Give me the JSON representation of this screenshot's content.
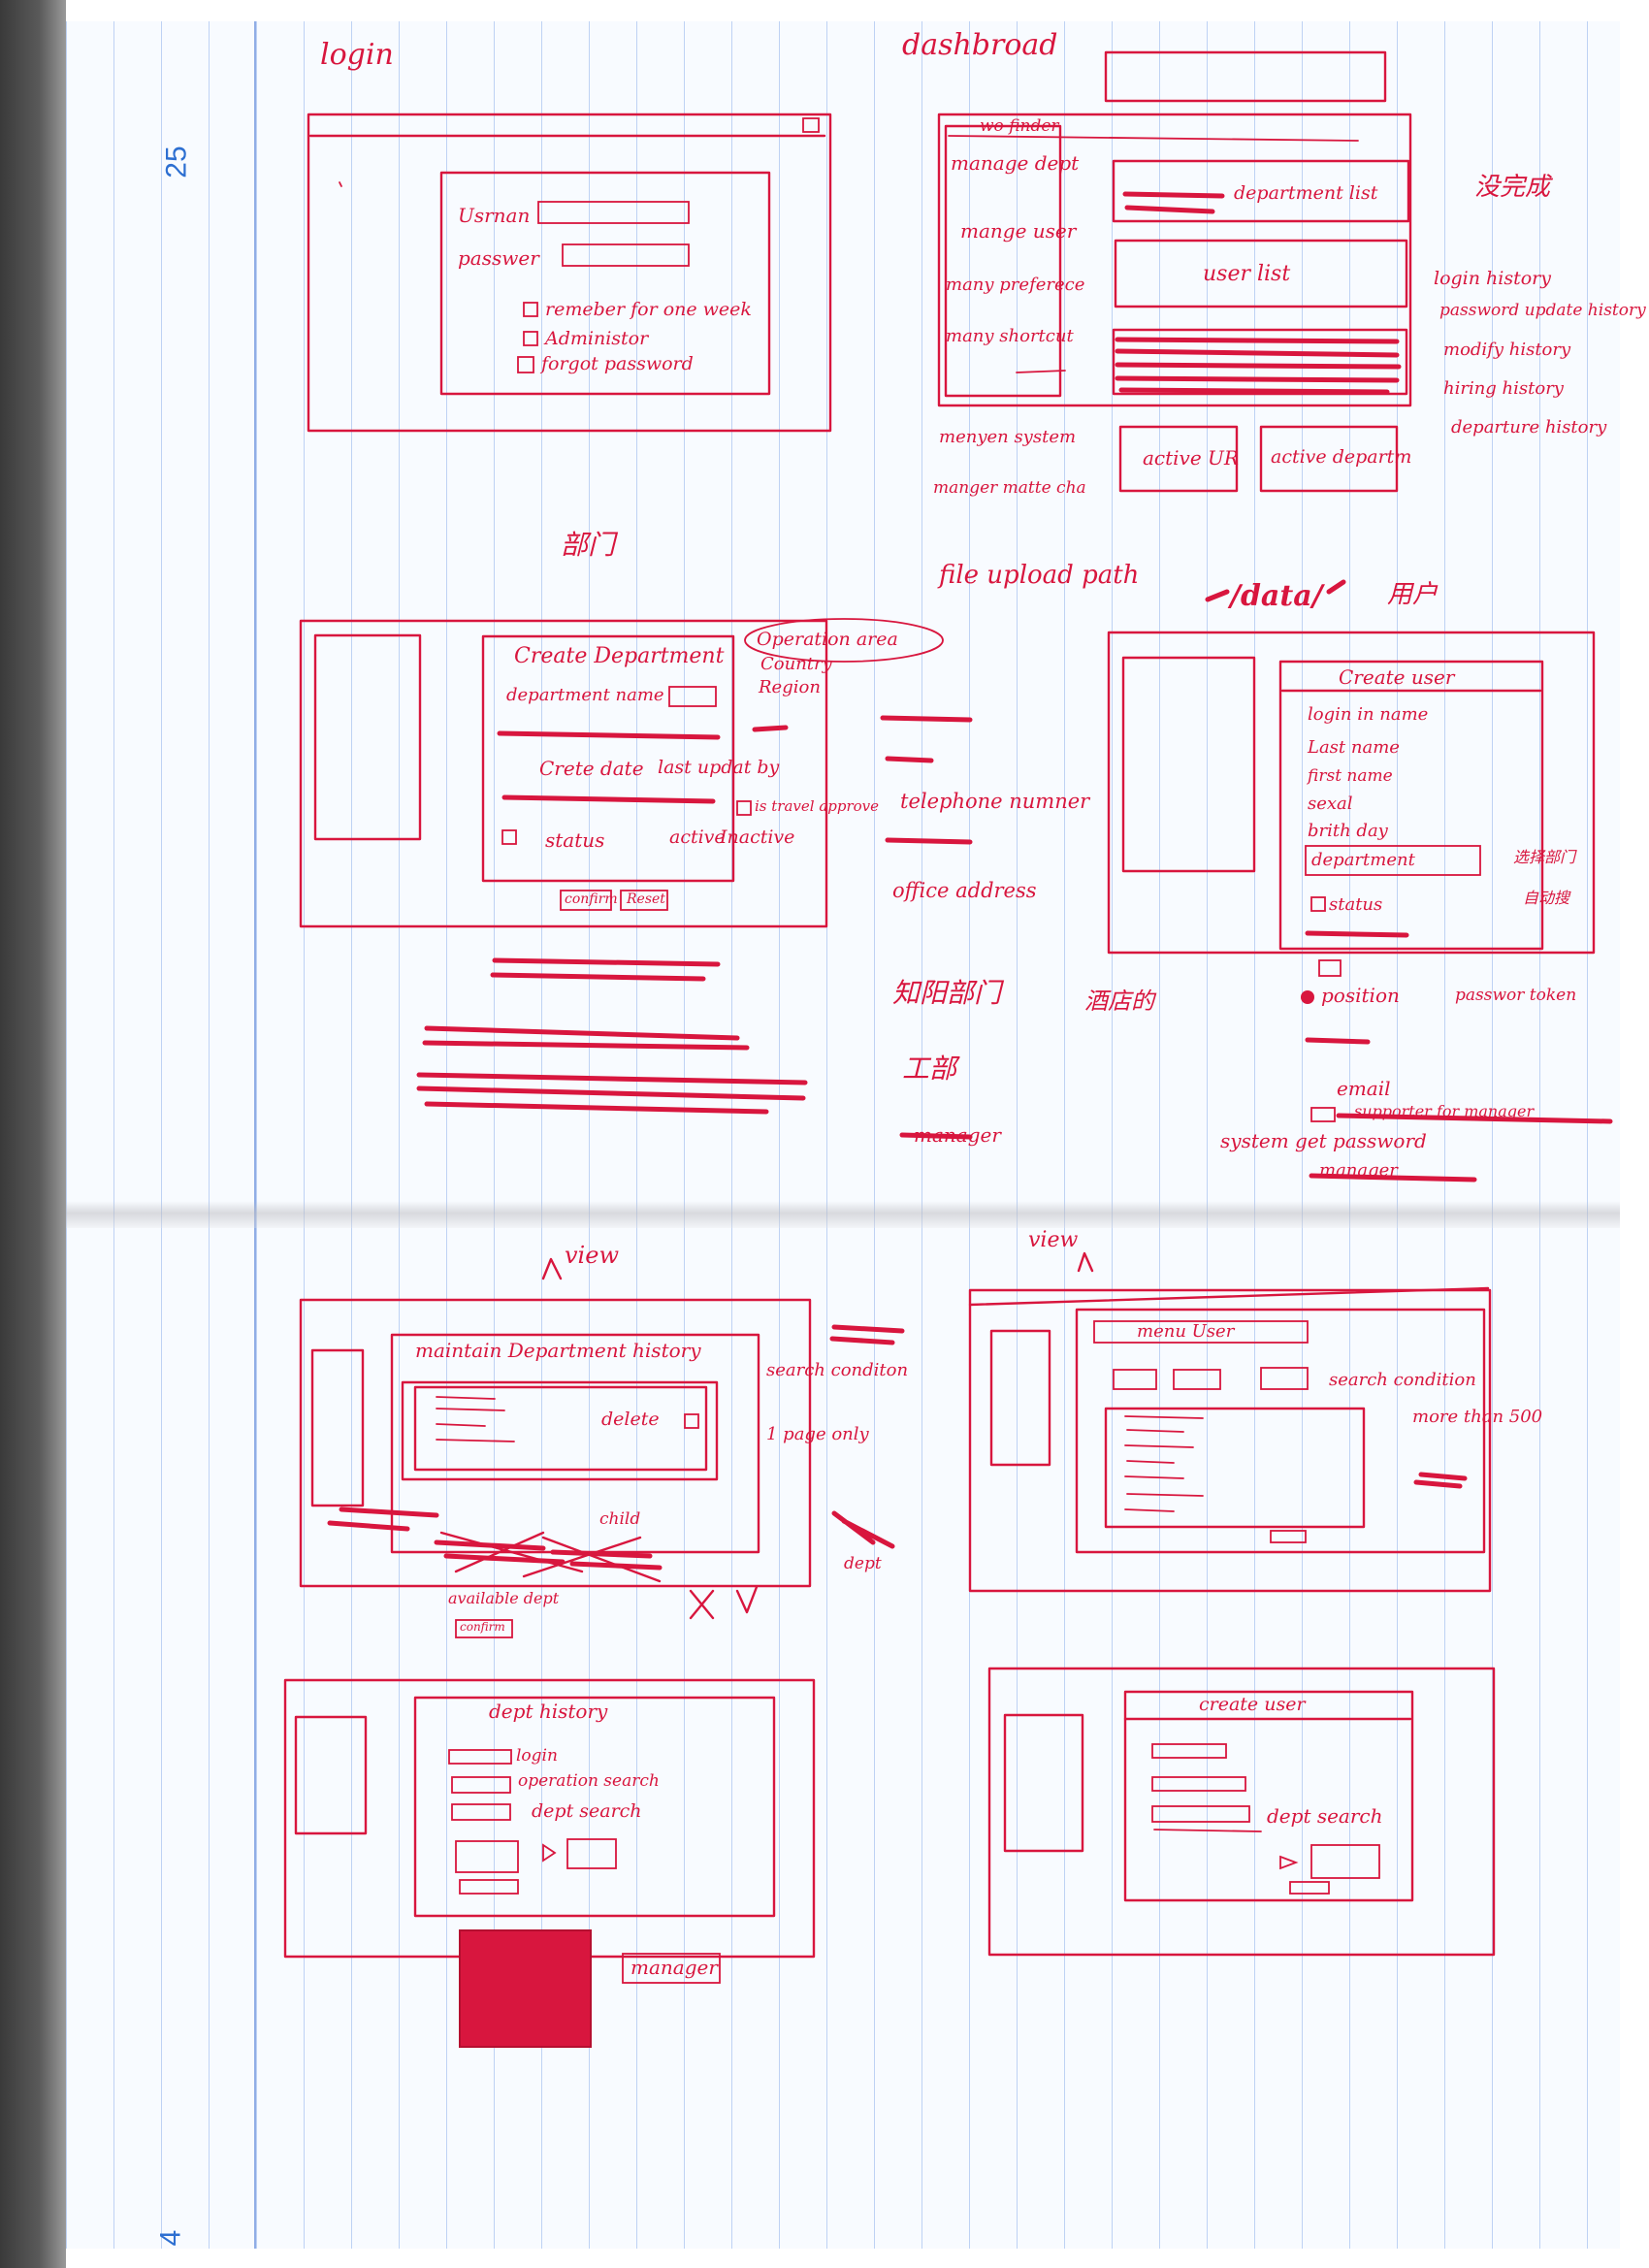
{
  "page": {
    "number_top": "25",
    "number_bottom": "4"
  },
  "login": {
    "title": "login",
    "username": "Usrnan",
    "password": "passwer",
    "remember": "remeber for one week",
    "administrator": "Administor",
    "forgot": "forgot password"
  },
  "dashboard": {
    "title": "dashbroad",
    "tree_top": "wo finder",
    "manage_dept": "manage dept",
    "manage_user": "mange user",
    "manage_preference": "many preferece",
    "manage_shortcut": "many shortcut",
    "manage_system": "menyen system",
    "manage_matching": "manger matte cha",
    "department_list": "department list",
    "user_list": "user list",
    "active_user": "active UR",
    "active_dept": "active departm",
    "annotation_cn": "没完成",
    "history": [
      "login history",
      "password update history",
      "modify history",
      "hiring history",
      "departure history"
    ]
  },
  "create_dept": {
    "heading_cn": "部门",
    "title": "Create Department",
    "department_name": "department name",
    "create_date": "Crete date",
    "last_updated": "last updat by",
    "travel_approve": "is travel approve",
    "status": "status",
    "active": "active",
    "inactive": "Inactive",
    "confirm": "confirm",
    "reset": "Reset",
    "operation_area": "Operation area",
    "country": "Country",
    "region": "Region",
    "telephone": "telephone numner",
    "office_address": "office address",
    "cn_1": "知阳部门",
    "cn_2": "工部",
    "cn_3": "酒店的",
    "manager": "manager"
  },
  "create_user": {
    "file_upload": "file upload path",
    "data": "/data/",
    "heading_cn": "用户",
    "title": "Create user",
    "login_name": "login in name",
    "last_name": "Last name",
    "first_name": "first name",
    "sex": "sexal",
    "birthday": "brith day",
    "department": "department",
    "cn_dept": "选择部门",
    "cn_search": "自动搜",
    "status": "status",
    "position": "position",
    "password_token": "passwor token",
    "email": "email",
    "supporter": "supporter for manager",
    "system_get_password": "system get password",
    "manager": "manager"
  },
  "maintain_view": {
    "view": "view",
    "title": "maintain Department history",
    "delete": "delete",
    "search_condition": "search conditon",
    "one_page_only": "1 page only",
    "child": "child",
    "available_dept": "available dept",
    "confirm": "confirm",
    "dept": "dept"
  },
  "user_view": {
    "view": "view",
    "title": "menu User",
    "search_condition": "search condition",
    "more_than": "more than 500"
  },
  "dept_history": {
    "title": "dept history",
    "login": "login",
    "operation_search": "operation search",
    "dept_search": "dept search",
    "manager": "manager"
  },
  "create_user2": {
    "title": "create user",
    "dept_search": "dept search"
  }
}
